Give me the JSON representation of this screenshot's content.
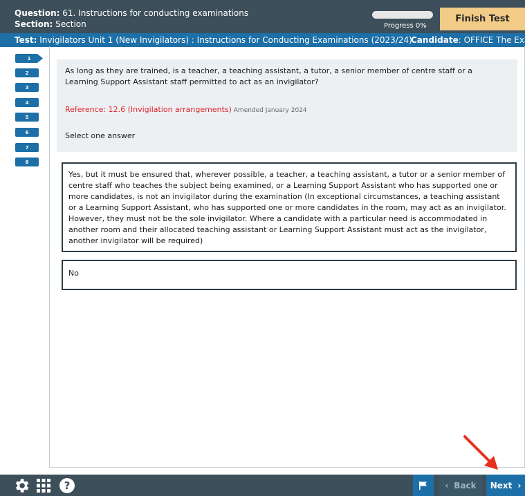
{
  "header": {
    "question_label": "Question:",
    "question_value": " 61. Instructions for conducting examinations",
    "section_label": "Section:",
    "section_value": " Section",
    "progress_label": "Progress 0%",
    "progress_fraction": 0.0,
    "finish_label": "Finish Test"
  },
  "test_bar": {
    "test_label": "Test:",
    "test_value": " Invigilators Unit 1 (New Invigilators) : Instructions for Conducting Examinations (2023/24)",
    "candidate_label": "Candidate",
    "candidate_value": ": OFFICE The Exams"
  },
  "question_nav": [
    "1",
    "2",
    "3",
    "4",
    "5",
    "6",
    "7",
    "8"
  ],
  "question": {
    "text": "As long as they are trained, is a teacher, a teaching assistant, a tutor, a senior member of centre staff or a Learning Support Assistant staff permitted to act as an invigilator?",
    "reference": "Reference: 12.6 (Invigilation arrangements)",
    "amended": " Amended January 2024",
    "instruction": "Select one answer"
  },
  "answers": [
    "Yes, but it must be ensured that, wherever possible, a teacher, a teaching assistant, a tutor or a senior member of centre staff who teaches the subject being examined, or a Learning Support Assistant who has supported one or more candidates, is not an invigilator during the examination (In exceptional circumstances, a teaching assistant or a Learning Support Assistant, who has supported one or more candidates in the room, may act as an invigilator. However, they must not be the sole invigilator. Where a candidate with a particular need is accommodated in another room and their allocated teaching assistant or Learning Support Assistant must act as the invigilator, another invigilator will be required)",
    "No"
  ],
  "footer": {
    "back_label": "Back",
    "next_label": "Next",
    "help_glyph": "?",
    "icons": [
      "gear-icon",
      "grid-icon",
      "help-icon",
      "flag-icon",
      "chevron-left-icon",
      "chevron-right-icon"
    ]
  },
  "colors": {
    "header_bg": "#3d4f5a",
    "accent_blue": "#1d6fa7",
    "finish_button": "#f2cb87",
    "reference_red": "#e0242c",
    "annotation_arrow": "#e8301e"
  }
}
